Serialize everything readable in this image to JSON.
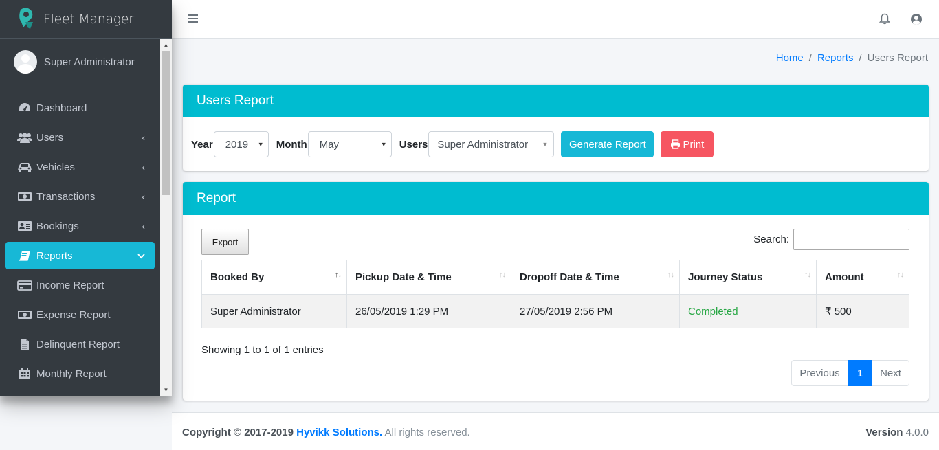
{
  "app": {
    "brand": "Fleet Manager"
  },
  "sidebar": {
    "user_name": "Super Administrator",
    "items": [
      {
        "label": "Dashboard",
        "icon": "dashboard-icon",
        "has_chevron": false
      },
      {
        "label": "Users",
        "icon": "users-icon",
        "has_chevron": true
      },
      {
        "label": "Vehicles",
        "icon": "car-icon",
        "has_chevron": true
      },
      {
        "label": "Transactions",
        "icon": "money-icon",
        "has_chevron": true
      },
      {
        "label": "Bookings",
        "icon": "address-card-icon",
        "has_chevron": true
      },
      {
        "label": "Reports",
        "icon": "book-icon",
        "has_chevron": true,
        "active": true
      },
      {
        "label": "Income Report",
        "icon": "credit-card-icon",
        "has_chevron": false
      },
      {
        "label": "Expense Report",
        "icon": "money-icon",
        "has_chevron": false
      },
      {
        "label": "Delinquent Report",
        "icon": "file-icon",
        "has_chevron": false
      },
      {
        "label": "Monthly Report",
        "icon": "calendar-icon",
        "has_chevron": false
      }
    ]
  },
  "breadcrumb": {
    "home": "Home",
    "reports": "Reports",
    "current": "Users Report",
    "separator": "/"
  },
  "filter_card": {
    "title": "Users Report",
    "year_label": "Year",
    "year_value": "2019",
    "month_label": "Month",
    "month_value": "May",
    "users_label": "Users",
    "users_value": "Super Administrator",
    "generate_label": "Generate Report",
    "print_label": "Print"
  },
  "report_card": {
    "title": "Report",
    "export_label": "Export",
    "search_label": "Search:",
    "columns": [
      "Booked By",
      "Pickup Date & Time",
      "Dropoff Date & Time",
      "Journey Status",
      "Amount"
    ],
    "rows": [
      {
        "booked_by": "Super Administrator",
        "pickup": "26/05/2019 1:29 PM",
        "dropoff": "27/05/2019 2:56 PM",
        "status": "Completed",
        "amount": "₹ 500"
      }
    ],
    "info": "Showing 1 to 1 of 1 entries",
    "pager": {
      "previous": "Previous",
      "page": "1",
      "next": "Next"
    }
  },
  "footer": {
    "copyright": "Copyright © 2017-2019",
    "company": "Hyvikk Solutions.",
    "rights": "All rights reserved.",
    "version_label": "Version",
    "version": "4.0.0"
  },
  "colors": {
    "accent": "#00bcd0",
    "sidebar": "#343a40",
    "active": "#17b8d6",
    "danger": "#f65561",
    "primary": "#007bff",
    "success": "#28a745"
  }
}
